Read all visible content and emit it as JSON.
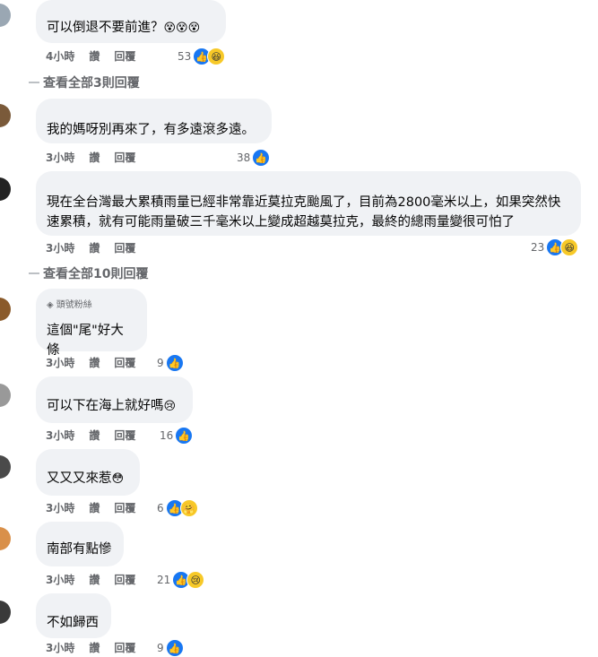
{
  "comments": [
    {
      "text": "可以倒退不要前進？",
      "emoji": "😵😵😵",
      "time": "4小時",
      "like": "讚",
      "reply": "回覆",
      "count": "53",
      "reacts": [
        "like-icon",
        "haha-icon"
      ]
    },
    {
      "text": "我的媽呀別再來了，有多遠滾多遠。",
      "time": "3小時",
      "like": "讚",
      "reply": "回覆",
      "count": "38",
      "reacts": [
        "like-icon"
      ]
    },
    {
      "text": "現在全台灣最大累積雨量已經非常靠近莫拉克颱風了，目前為2800毫米以上，如果突然快速累積，就有可能雨量破三千毫米以上變成超越莫拉克，最終的總雨量變很可怕了",
      "time": "3小時",
      "like": "讚",
      "reply": "回覆",
      "count": "23",
      "reacts": [
        "like-icon",
        "haha-icon"
      ]
    },
    {
      "badge": "頭號粉絲",
      "text": "這個\"尾\"好大條",
      "time": "3小時",
      "like": "讚",
      "reply": "回覆",
      "count": "9",
      "reacts": [
        "like-icon"
      ]
    },
    {
      "text": "可以下在海上就好嗎",
      "emoji": "😢",
      "time": "3小時",
      "like": "讚",
      "reply": "回覆",
      "count": "16",
      "reacts": [
        "like-icon"
      ]
    },
    {
      "text": "又又又來惹",
      "emoji": "😳",
      "time": "3小時",
      "like": "讚",
      "reply": "回覆",
      "count": "6",
      "reacts": [
        "like-icon",
        "care-icon"
      ]
    },
    {
      "text": "南部有點慘",
      "time": "3小時",
      "like": "讚",
      "reply": "回覆",
      "count": "21",
      "reacts": [
        "like-icon",
        "sad-icon"
      ]
    },
    {
      "text": "不如歸西",
      "time": "3小時",
      "like": "讚",
      "reply": "回覆",
      "count": "9",
      "reacts": [
        "like-icon"
      ]
    }
  ],
  "view_all": [
    "查看全部3則回覆",
    "查看全部10則回覆"
  ],
  "colors": {
    "like": "#1877f2",
    "bubble": "#f0f2f5",
    "meta": "#65676b"
  }
}
